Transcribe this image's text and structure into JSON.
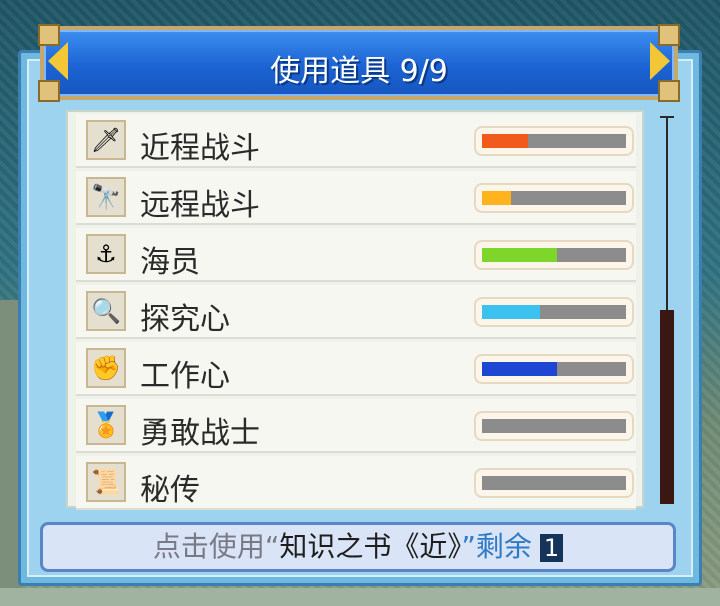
{
  "header": {
    "title": "使用道具 9/9"
  },
  "items": [
    {
      "label": "近程战斗",
      "icon": "sword-icon",
      "level": 0.32,
      "color": "#f15a1a"
    },
    {
      "label": "远程战斗",
      "icon": "spyglass-icon",
      "level": 0.2,
      "color": "#ffb41e"
    },
    {
      "label": "海员",
      "icon": "anchor-icon",
      "level": 0.52,
      "color": "#7ed62a"
    },
    {
      "label": "探究心",
      "icon": "magnifier-icon",
      "level": 0.4,
      "color": "#3cc2ee"
    },
    {
      "label": "工作心",
      "icon": "fist-icon",
      "level": 0.52,
      "color": "#1e46d2"
    },
    {
      "label": "勇敢战士",
      "icon": "medal-icon",
      "level": 0.0,
      "color": "#8c8c8c"
    },
    {
      "label": "秘传",
      "icon": "scroll-icon",
      "level": 0.0,
      "color": "#8c8c8c"
    }
  ],
  "footer": {
    "prefix": "点击使用“",
    "book": "知识之书《近》",
    "suffix": "”剩余",
    "count": "1"
  }
}
